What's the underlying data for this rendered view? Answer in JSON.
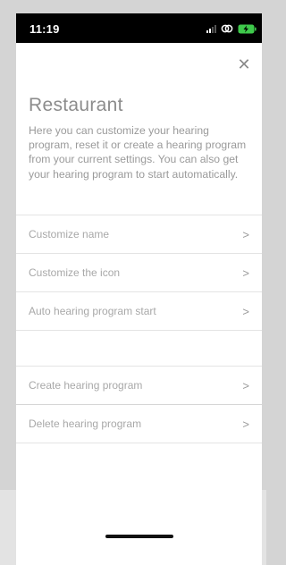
{
  "status_bar": {
    "time": "11:19",
    "icons": [
      "signal-icon",
      "link-icon",
      "battery-charging-icon"
    ],
    "battery_color": "#3ec94b"
  },
  "screen": {
    "close_icon": "close-icon",
    "title": "Restaurant",
    "description": "Here you can customize your hearing program, reset it or create a hearing program from your current settings. You can also get your hearing program to start automatically."
  },
  "menu": {
    "group1": [
      {
        "label": "Customize name",
        "icon": "chevron-right-icon"
      },
      {
        "label": "Customize the icon",
        "icon": "chevron-right-icon"
      },
      {
        "label": "Auto hearing program start",
        "icon": "chevron-right-icon"
      }
    ],
    "group2": [
      {
        "label": "Create hearing program",
        "icon": "chevron-right-icon"
      },
      {
        "label": "Delete hearing program",
        "icon": "chevron-right-icon"
      }
    ]
  }
}
